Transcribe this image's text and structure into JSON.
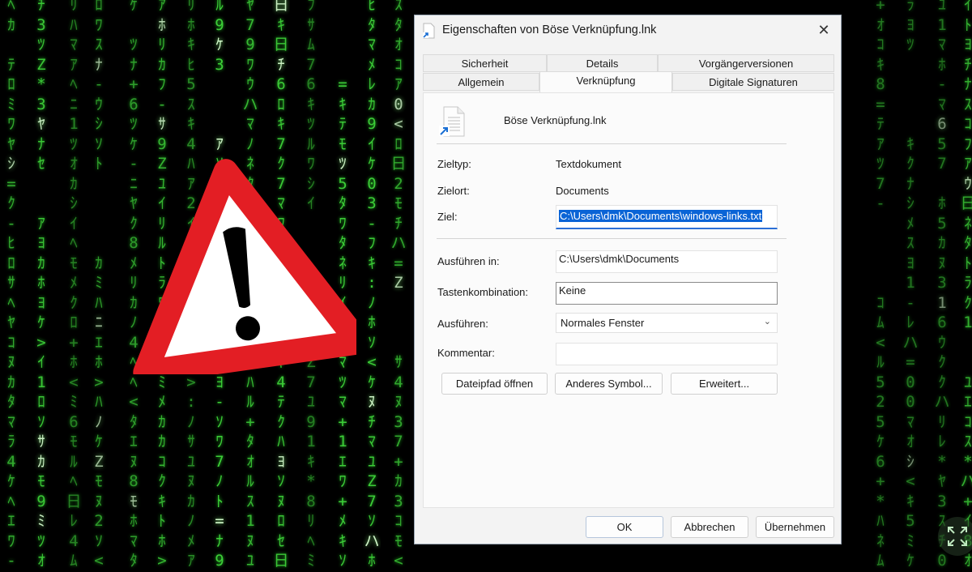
{
  "dialog": {
    "title": "Eigenschaften von Böse Verknüpfung.lnk",
    "close_symbol": "✕",
    "tabs_row1": [
      "Sicherheit",
      "Details",
      "Vorgängerversionen"
    ],
    "tabs_row2": [
      "Allgemein",
      "Verknüpfung",
      "Digitale Signaturen"
    ],
    "active_tab": "Verknüpfung",
    "file_name": "Böse Verknüpfung.lnk",
    "fields": {
      "zieltyp_label": "Zieltyp:",
      "zieltyp_value": "Textdokument",
      "zielort_label": "Zielort:",
      "zielort_value": "Documents",
      "ziel_label": "Ziel:",
      "ziel_value": "C:\\Users\\dmk\\Documents\\windows-links.txt",
      "ausfuehren_in_label": "Ausführen in:",
      "ausfuehren_in_value": "C:\\Users\\dmk\\Documents",
      "tastenkombination_label": "Tastenkombination:",
      "tastenkombination_value": "Keine",
      "ausfuehren_label": "Ausführen:",
      "ausfuehren_value": "Normales Fenster",
      "kommentar_label": "Kommentar:",
      "kommentar_value": ""
    },
    "buttons": {
      "open_path": "Dateipfad öffnen",
      "other_icon": "Anderes Symbol...",
      "advanced": "Erweitert...",
      "ok": "OK",
      "cancel": "Abbrechen",
      "apply": "Übernehmen"
    }
  },
  "icons": {
    "warning": "warning-triangle-icon",
    "shortcut_arrow": "shortcut-arrow-icon",
    "expand": "expand-icon"
  },
  "colors": {
    "warning_red": "#e31e24",
    "matrix_green": "#3fd43a",
    "selection_blue": "#0a64d6"
  }
}
